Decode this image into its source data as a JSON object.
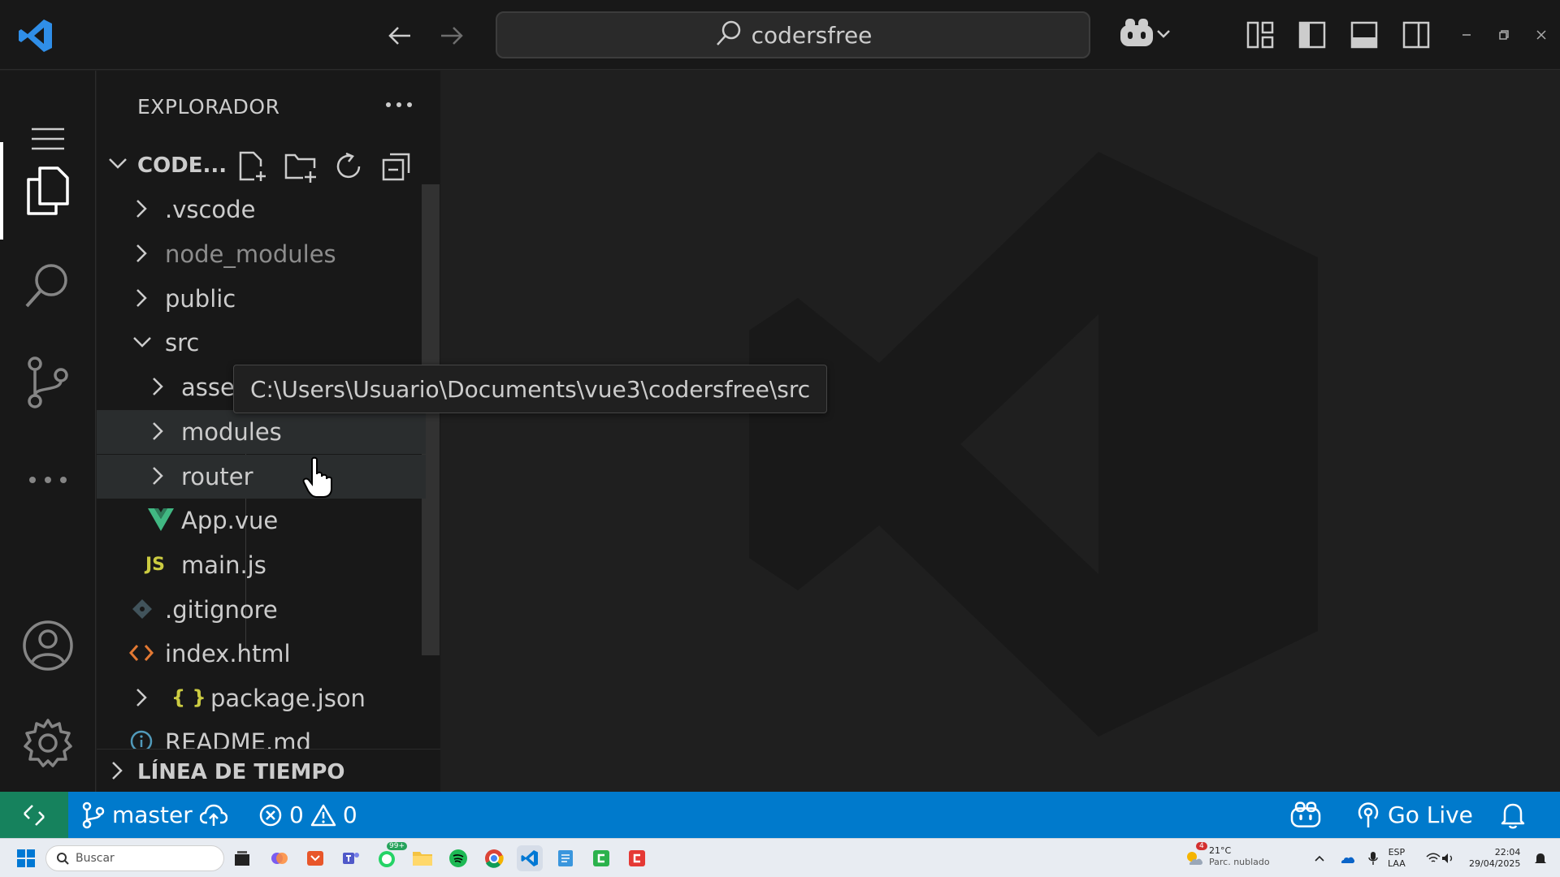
{
  "titlebar": {
    "search_text": "codersfree"
  },
  "sidebar": {
    "title": "EXPLORADOR",
    "folder_name": "CODE...",
    "tree": [
      {
        "label": ".vscode",
        "type": "folder"
      },
      {
        "label": "node_modules",
        "type": "folder"
      },
      {
        "label": "public",
        "type": "folder"
      },
      {
        "label": "src",
        "type": "folder-open"
      },
      {
        "label": "asse",
        "type": "folder"
      },
      {
        "label": "modules",
        "type": "folder"
      },
      {
        "label": "router",
        "type": "folder"
      },
      {
        "label": "App.vue",
        "type": "vue-file"
      },
      {
        "label": "main.js",
        "type": "js-file"
      },
      {
        "label": ".gitignore",
        "type": "git-file"
      },
      {
        "label": "index.html",
        "type": "html-file"
      },
      {
        "label": "package.json",
        "type": "json-file"
      },
      {
        "label": "README.md",
        "type": "info-file"
      }
    ],
    "js_badge": "JS",
    "json_badge": "{ }",
    "timeline_label": "LÍNEA DE TIEMPO"
  },
  "tooltip": {
    "text": "C:\\Users\\Usuario\\Documents\\vue3\\codersfree\\src"
  },
  "statusbar": {
    "branch": "master",
    "errors": "0",
    "warnings": "0",
    "go_live": "Go Live"
  },
  "taskbar": {
    "search_placeholder": "Buscar",
    "whatsapp_badge": "99+",
    "weather_badge": "4",
    "weather_temp": "21°C",
    "weather_desc": "Parc. nublado",
    "lang_1": "ESP",
    "lang_2": "LAA",
    "time": "22:04",
    "date": "29/04/2025"
  },
  "colors": {
    "accent": "#007acc",
    "remote": "#16825d",
    "vue_green": "#41b883",
    "js_yellow": "#cbcb41",
    "html_orange": "#e37933"
  }
}
